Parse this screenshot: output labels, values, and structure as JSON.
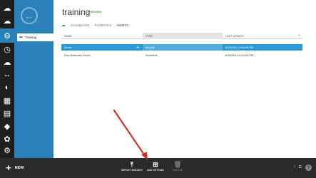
{
  "header": {
    "title": "training",
    "preview_badge": "PREVIEW"
  },
  "tabs": [
    {
      "label": "DASHBOARD"
    },
    {
      "label": "RUNBOOKS"
    },
    {
      "label": "ASSETS"
    }
  ],
  "nav": {
    "selected_item": "Training"
  },
  "table": {
    "columns": [
      "NAME",
      "TYPE",
      "LAST UPDATE"
    ],
    "rows": [
      {
        "name": "Azure",
        "type": "Module",
        "last_update": "6/13/2014 4:09:26 PM",
        "selected": true
      },
      {
        "name": "Non Business Hours",
        "type": "Schedule",
        "last_update": "6/16/2014 4:49:24 PM",
        "selected": false
      }
    ]
  },
  "commandbar": {
    "new_label": "NEW",
    "import_label": "IMPORT MODULE",
    "add_label": "ADD SETTING",
    "delete_label": "DELETE",
    "status_count": "2"
  },
  "colors": {
    "accent": "#2a82b8",
    "selection": "#2a9ad8",
    "annotation": "#c0392b"
  }
}
